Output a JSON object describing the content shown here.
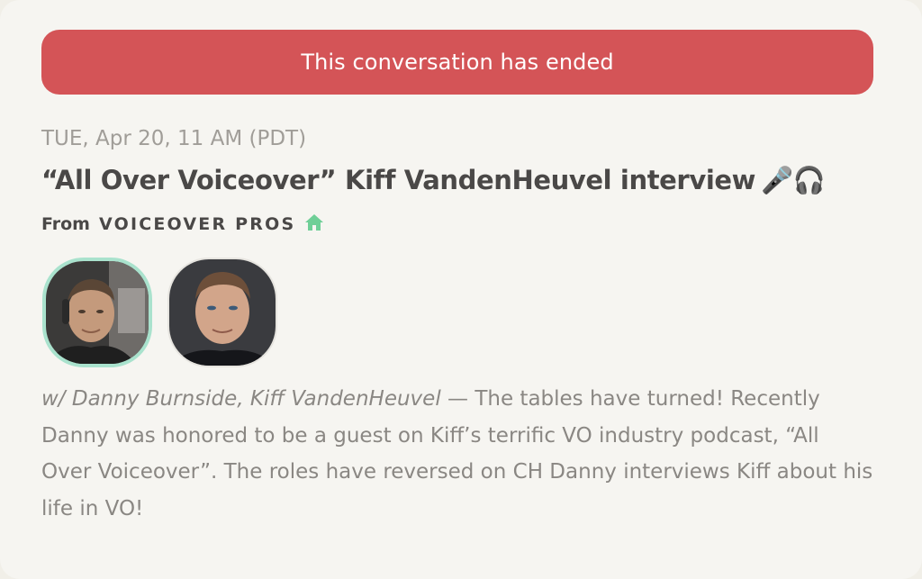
{
  "banner": {
    "text": "This conversation has ended"
  },
  "event": {
    "datetime": "TUE, Apr 20, 11 AM (PDT)",
    "title": "“All Over Voiceover” Kiff VandenHeuvel interview",
    "title_icons": "🎤🎧",
    "from_label": "From",
    "club_name": "VOICEOVER PROS",
    "club_icon": "home-icon",
    "club_icon_color": "#6fcf97",
    "with_names": "w/ Danny Burnside, Kiff VandenHeuvel",
    "separator": " — ",
    "description": "The tables have turned! Recently Danny was honored to be a guest on Kiff’s terrific VO industry podcast, “All Over Voiceover”. The roles have reversed on CH Danny interviews Kiff about his life in VO!"
  },
  "speakers": [
    {
      "name": "Danny Burnside",
      "ring_color": "#a9e2cd"
    },
    {
      "name": "Kiff VandenHeuvel",
      "ring_color": "#e6e4df"
    }
  ],
  "colors": {
    "banner_bg": "#d45457",
    "card_bg": "#f6f5f1",
    "title_text": "#4a4847",
    "muted_text": "#a09d98"
  }
}
